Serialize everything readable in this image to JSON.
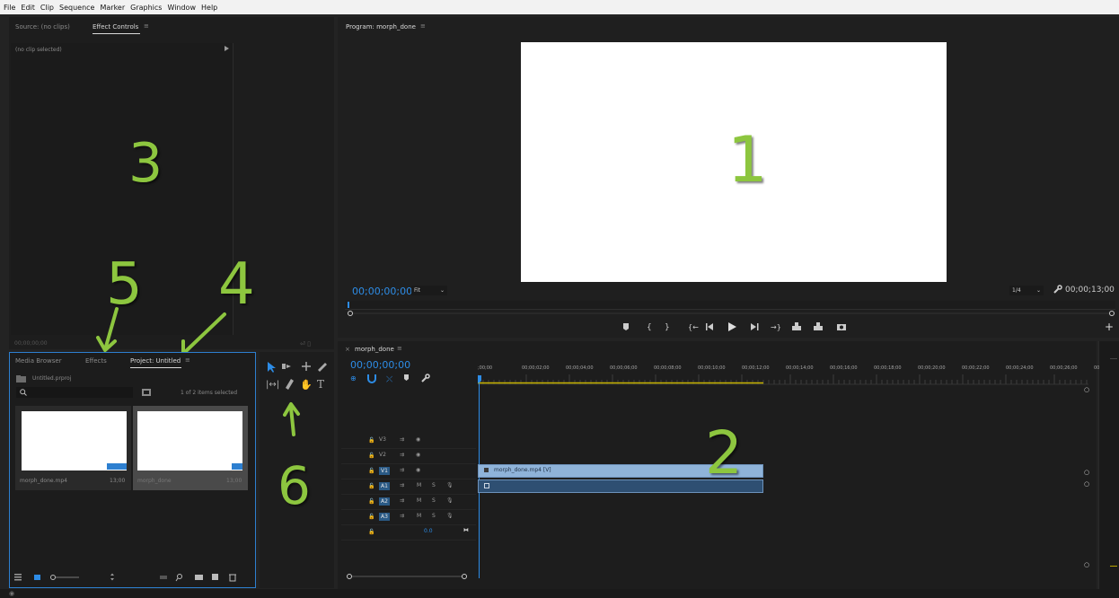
{
  "menu": [
    "File",
    "Edit",
    "Clip",
    "Sequence",
    "Marker",
    "Graphics",
    "Window",
    "Help"
  ],
  "source_panel": {
    "tab_source": "Source: (no clips)",
    "tab_effect_controls": "Effect Controls",
    "menu_glyph": "≡",
    "no_clip_label": "(no clip selected)",
    "timecode": "00;00;00;00"
  },
  "project_panel": {
    "tab_media_browser": "Media Browser",
    "tab_effects": "Effects",
    "tab_project": "Project: Untitled",
    "menu_glyph": "≡",
    "project_file": "Untitled.prproj",
    "selection_status": "1 of 2 items selected",
    "items": [
      {
        "name": "morph_done.mp4",
        "duration": "13;00"
      },
      {
        "name": "morph_done",
        "duration": "13;00"
      }
    ]
  },
  "program_monitor": {
    "title": "Program: morph_done",
    "menu_glyph": "≡",
    "timecode_left": "00;00;00;00",
    "fit_select": "Fit",
    "resolution_select": "1/4",
    "timecode_right": "00;00;13;00"
  },
  "timeline": {
    "sequence_tab": "morph_done",
    "menu_glyph": "≡",
    "timecode": "00;00;00;00",
    "ruler": [
      ";00;00",
      "00;00;02;00",
      "00;00;04;00",
      "00;00;06;00",
      "00;00;08;00",
      "00;00;10;00",
      "00;00;12;00",
      "00;00;14;00",
      "00;00;16;00",
      "00;00;18;00",
      "00;00;20;00",
      "00;00;22;00",
      "00;00;24;00",
      "00;00;26;00",
      "00"
    ],
    "video_tracks": [
      "V3",
      "V2",
      "V1"
    ],
    "audio_tracks": [
      "A1",
      "A2",
      "A3"
    ],
    "track_m": "M",
    "track_s": "S",
    "master_value": "0.0",
    "video_clip_label": "morph_done.mp4 [V]"
  },
  "annotations": {
    "n1": "1",
    "n2": "2",
    "n3": "3",
    "n4": "4",
    "n5": "5",
    "n6": "6"
  },
  "colors": {
    "annotation_green": "#8dc63f",
    "timecode_blue": "#2d8ce6",
    "panel_focus_border": "#2d7fd0",
    "clip_video": "#8fb3d9",
    "clip_audio": "#2e4f72"
  }
}
